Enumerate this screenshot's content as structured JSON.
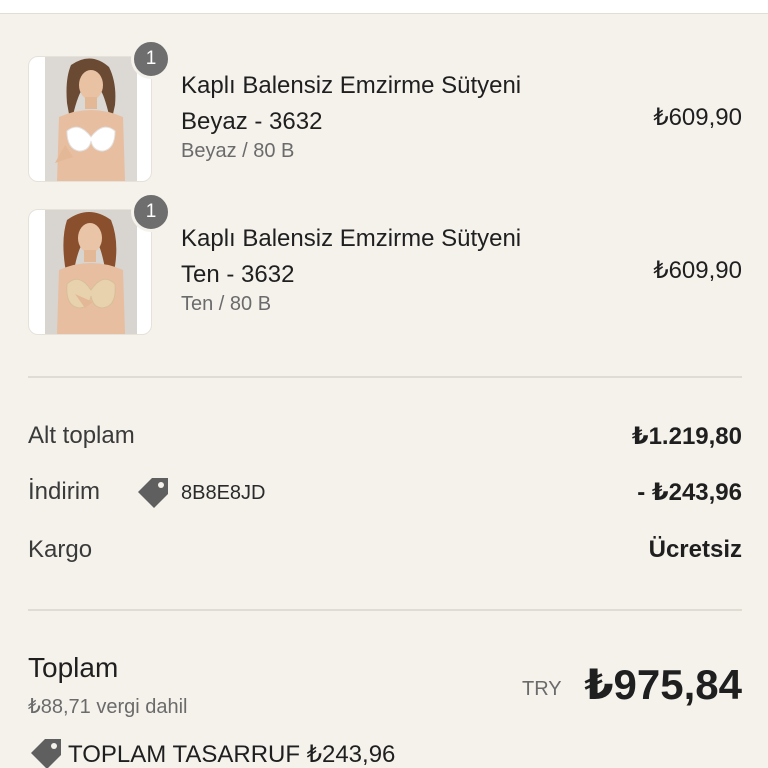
{
  "order": {
    "items": [
      {
        "quantity": "1",
        "title_line1": "Kaplı Balensiz Emzirme Sütyeni",
        "title_line2": "Beyaz - 3632",
        "variant": "Beyaz / 80 B",
        "price": "₺609,90",
        "image": "white-nursing-bra-photo"
      },
      {
        "quantity": "1",
        "title_line1": "Kaplı Balensiz Emzirme Sütyeni",
        "title_line2": "Ten - 3632",
        "variant": "Ten / 80 B",
        "price": "₺609,90",
        "image": "nude-nursing-bra-photo"
      }
    ]
  },
  "summary": {
    "subtotal_label": "Alt toplam",
    "subtotal_value": "₺1.219,80",
    "discount_label": "İndirim",
    "discount_code": "8B8E8JD",
    "discount_value": "- ₺243,96",
    "shipping_label": "Kargo",
    "shipping_value": "Ücretsiz"
  },
  "total": {
    "label": "Toplam",
    "tax_note": "₺88,71 vergi dahil",
    "currency": "TRY",
    "value": "₺975,84"
  },
  "savings": {
    "text": "TOPLAM TASARRUF ₺243,96",
    "icon": "discount-tag-icon"
  },
  "colors": {
    "background": "#f5f2ec",
    "badge": "#6e6e6e",
    "tag_icon": "#5f5f5f"
  }
}
